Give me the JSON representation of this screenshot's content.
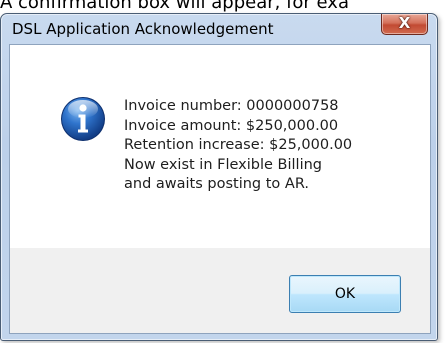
{
  "caption": "A confirmation box will appear, for exa",
  "dialog": {
    "title": "DSL Application Acknowledgement",
    "close_glyph": "X",
    "icon": "information-icon",
    "message_lines": [
      "Invoice number: 0000000758",
      "Invoice amount: $250,000.00",
      "Retention increase: $25,000.00",
      "Now exist in Flexible Billing",
      "and awaits posting to AR."
    ],
    "ok_label": "OK"
  },
  "colors": {
    "frame": "#bcd0ea",
    "close_button": "#c24a33",
    "ok_button_border": "#3c7fb1",
    "info_icon": "#1f5fb7"
  }
}
